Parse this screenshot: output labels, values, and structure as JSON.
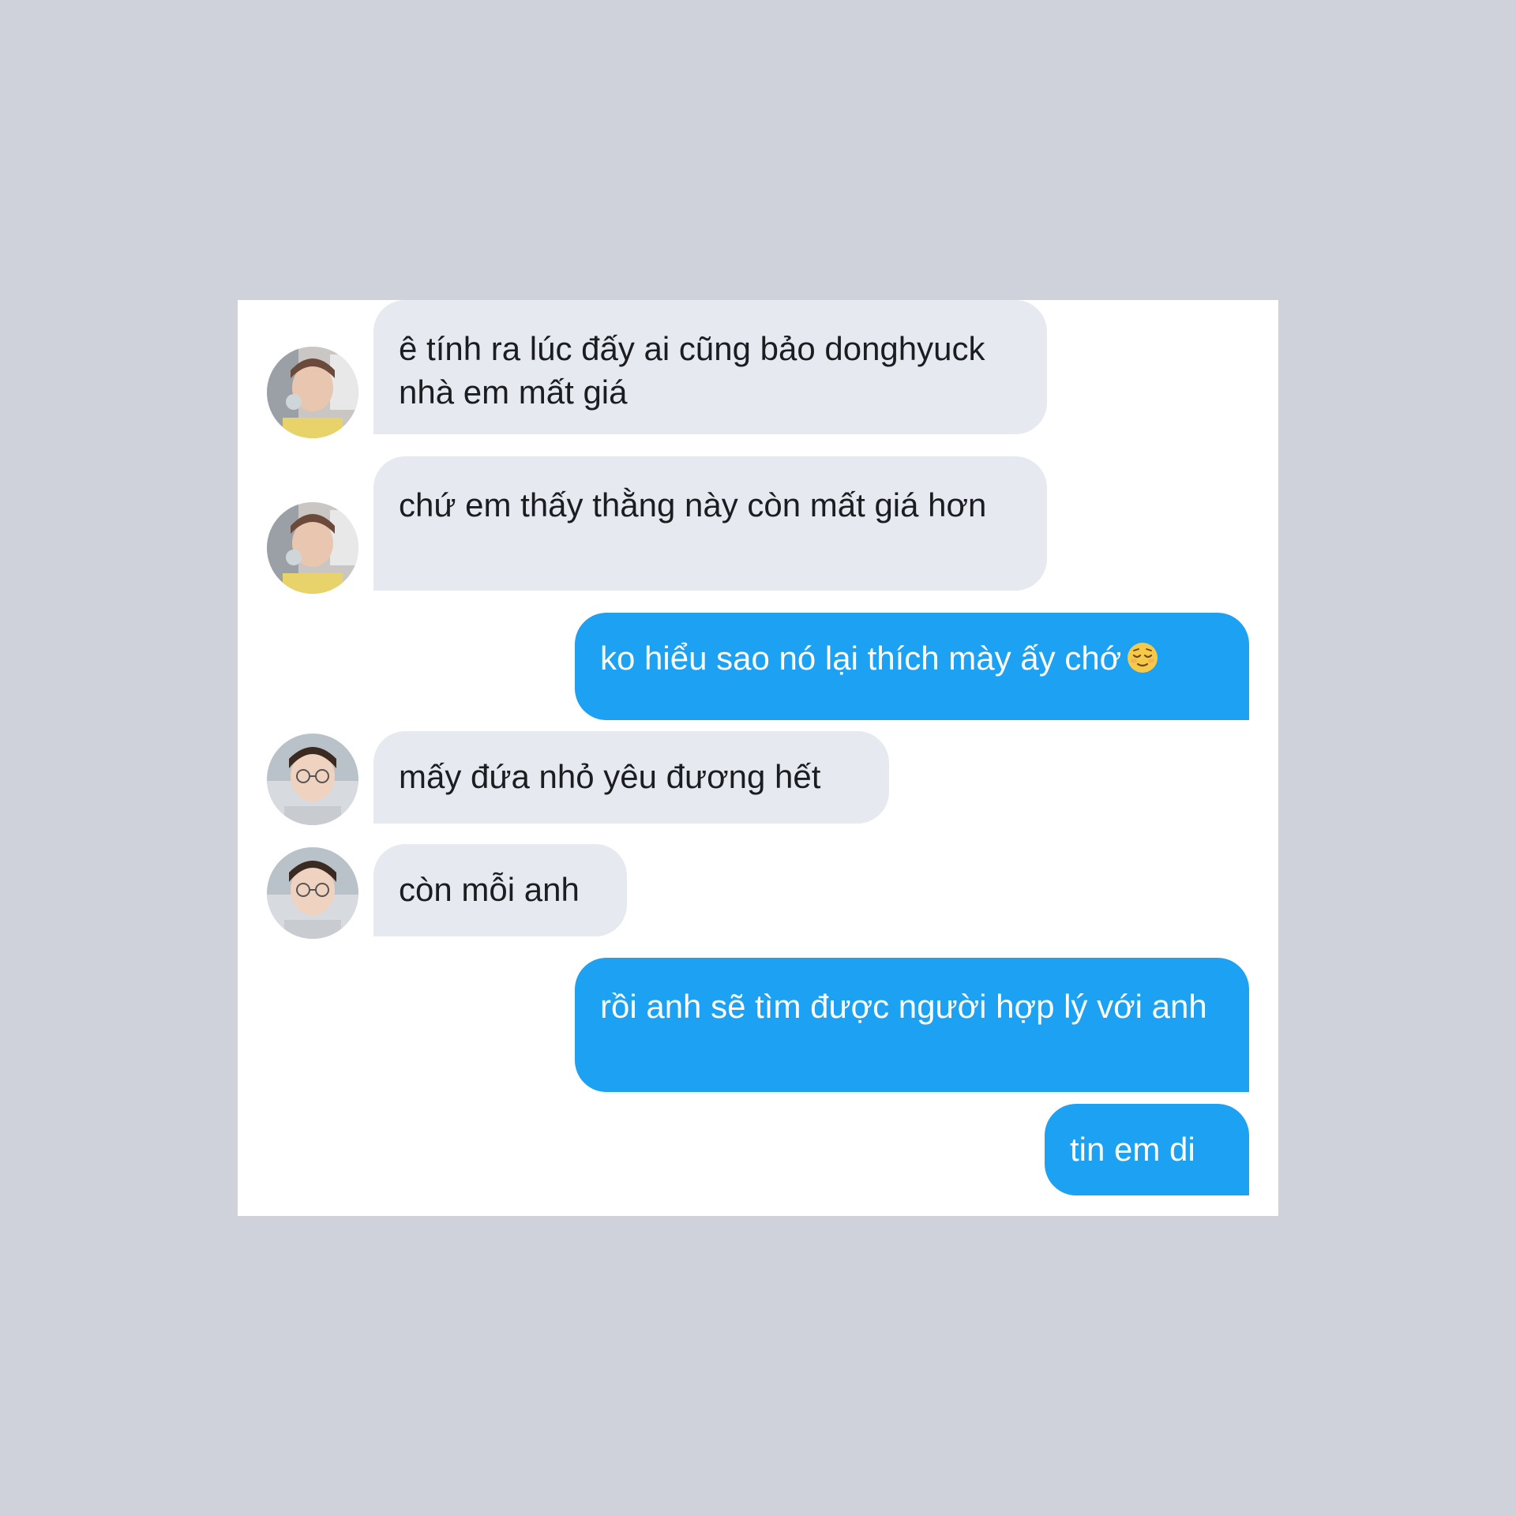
{
  "conversation": {
    "messages": [
      {
        "direction": "incoming",
        "avatar": "avatar-user-1",
        "text": "ê tính ra lúc đấy ai cũng bảo donghyuck nhà em mất giá"
      },
      {
        "direction": "incoming",
        "avatar": "avatar-user-1",
        "text": "chứ em thấy thằng này còn mất giá hơn"
      },
      {
        "direction": "outgoing",
        "text": "ko hiểu sao nó lại thích mày ấy chớ",
        "emoji": "relieved-face-emoji"
      },
      {
        "direction": "incoming",
        "avatar": "avatar-user-2",
        "text": "mấy đứa nhỏ yêu đương hết"
      },
      {
        "direction": "incoming",
        "avatar": "avatar-user-2",
        "text": "còn mỗi anh"
      },
      {
        "direction": "outgoing",
        "text": "rồi anh sẽ tìm được người hợp lý với anh"
      },
      {
        "direction": "outgoing",
        "text": "tin em di"
      }
    ]
  },
  "colors": {
    "background": "#cfd2db",
    "card": "#ffffff",
    "incoming_bubble": "#e6e9f0",
    "incoming_text": "#1b1d21",
    "outgoing_bubble": "#1da1f2",
    "outgoing_text": "#ffffff"
  }
}
